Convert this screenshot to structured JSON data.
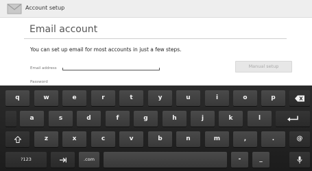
{
  "action_bar": {
    "title": "Account setup",
    "icon": "email-app-icon"
  },
  "page": {
    "title": "Email account",
    "description": "You can set up email for most accounts in just a few steps.",
    "email_label": "Email address",
    "email_value": "",
    "password_label": "Password",
    "manual_setup_label": "Manual setup"
  },
  "keyboard": {
    "row1": [
      "q",
      "w",
      "e",
      "r",
      "t",
      "y",
      "u",
      "i",
      "o",
      "p"
    ],
    "row2": [
      "a",
      "s",
      "d",
      "f",
      "g",
      "h",
      "j",
      "k",
      "l"
    ],
    "row3": [
      "z",
      "x",
      "c",
      "v",
      "b",
      "n",
      "m",
      ",",
      "."
    ],
    "at_key": "@",
    "numbers_key": "?123",
    "com_key": ".com",
    "dash_key": "-",
    "underscore_key": "_",
    "icons": {
      "backspace": "backspace-icon",
      "enter": "enter-icon",
      "shift": "shift-icon",
      "tab": "tab-icon",
      "mic": "mic-icon"
    }
  },
  "colors": {
    "keyboard_bg": "#222222",
    "key_bg": "#444444",
    "key_text": "#f2f2f2",
    "action_bar_bg": "#eeeeee"
  }
}
